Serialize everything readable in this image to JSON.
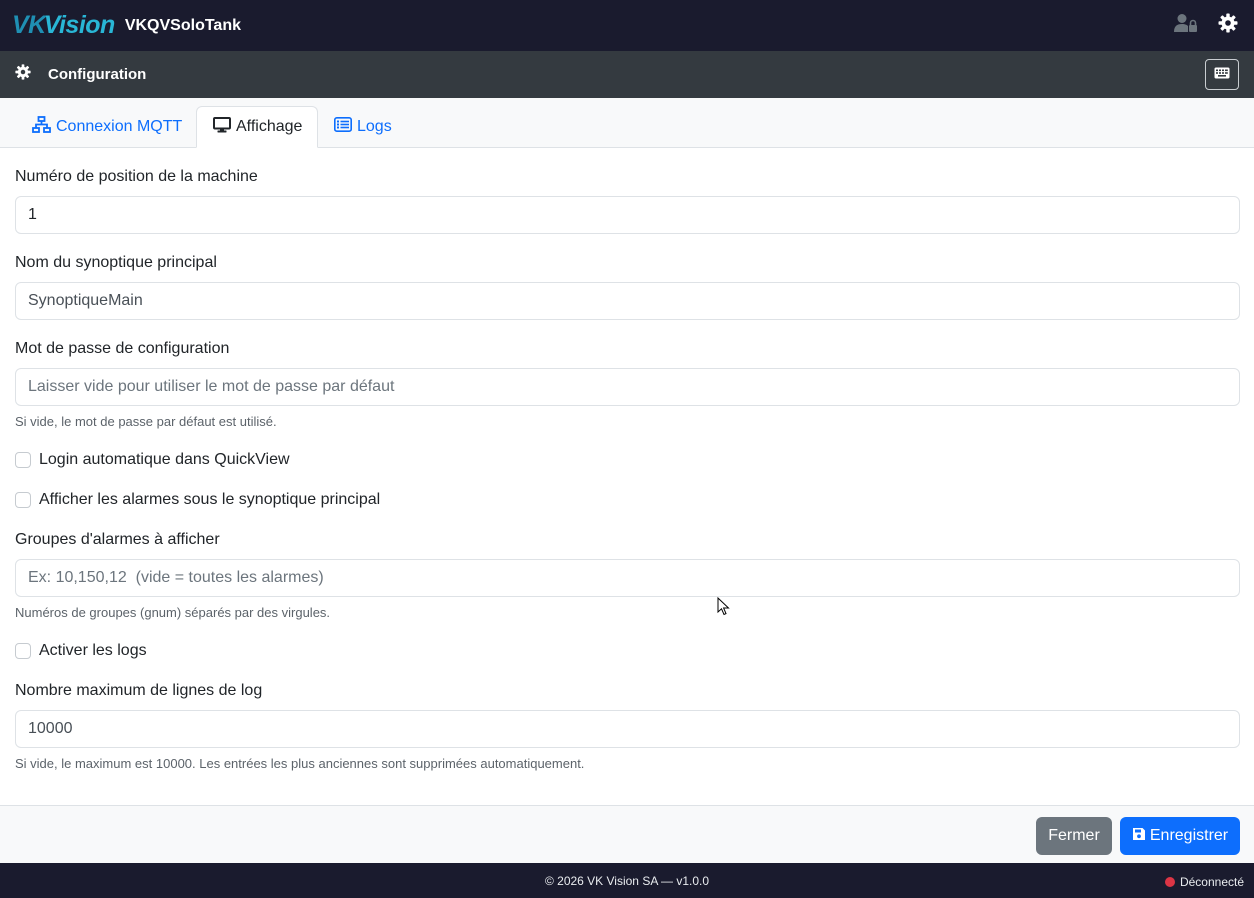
{
  "header": {
    "logo_text_vk": "VK",
    "logo_text_vision": "Vision",
    "app_title": "VKQVSoloTank",
    "icons": [
      "user-lock-icon",
      "gear-icon"
    ]
  },
  "config_bar": {
    "title": "Configuration",
    "icons": [
      "gear-icon",
      "keyboard-icon"
    ]
  },
  "tabs": [
    {
      "label": "Connexion MQTT",
      "icon": "network-icon",
      "active": false
    },
    {
      "label": "Affichage",
      "icon": "monitor-icon",
      "active": true
    },
    {
      "label": "Logs",
      "icon": "list-icon",
      "active": false
    }
  ],
  "form": {
    "position": {
      "label": "Numéro de position de la machine",
      "value": "1"
    },
    "synoptique": {
      "label": "Nom du synoptique principal",
      "value": "SynoptiqueMain"
    },
    "password": {
      "label": "Mot de passe de configuration",
      "placeholder": "Laisser vide pour utiliser le mot de passe par défaut",
      "help": "Si vide, le mot de passe par défaut est utilisé."
    },
    "auto_login": {
      "label": "Login automatique dans QuickView",
      "checked": false
    },
    "show_alarms": {
      "label": "Afficher les alarmes sous le synoptique principal",
      "checked": false
    },
    "alarm_groups": {
      "label": "Groupes d'alarmes à afficher",
      "placeholder": "Ex: 10,150,12  (vide = toutes les alarmes)",
      "help": "Numéros de groupes (gnum) séparés par des virgules."
    },
    "enable_logs": {
      "label": "Activer les logs",
      "checked": false
    },
    "max_log_lines": {
      "label": "Nombre maximum de lignes de log",
      "value": "10000",
      "help": "Si vide, le maximum est 10000. Les entrées les plus anciennes sont supprimées automatiquement."
    }
  },
  "actions": {
    "close_label": "Fermer",
    "save_label": "Enregistrer"
  },
  "status": {
    "copyright": "© 2026 VK Vision SA — v1.0.0",
    "connection": "Déconnecté",
    "connection_color": "#dc3545"
  },
  "colors": {
    "primary": "#0d6efd",
    "secondary": "#6c757d",
    "topbar": "#1a1b2e",
    "confbar": "#343a40"
  }
}
